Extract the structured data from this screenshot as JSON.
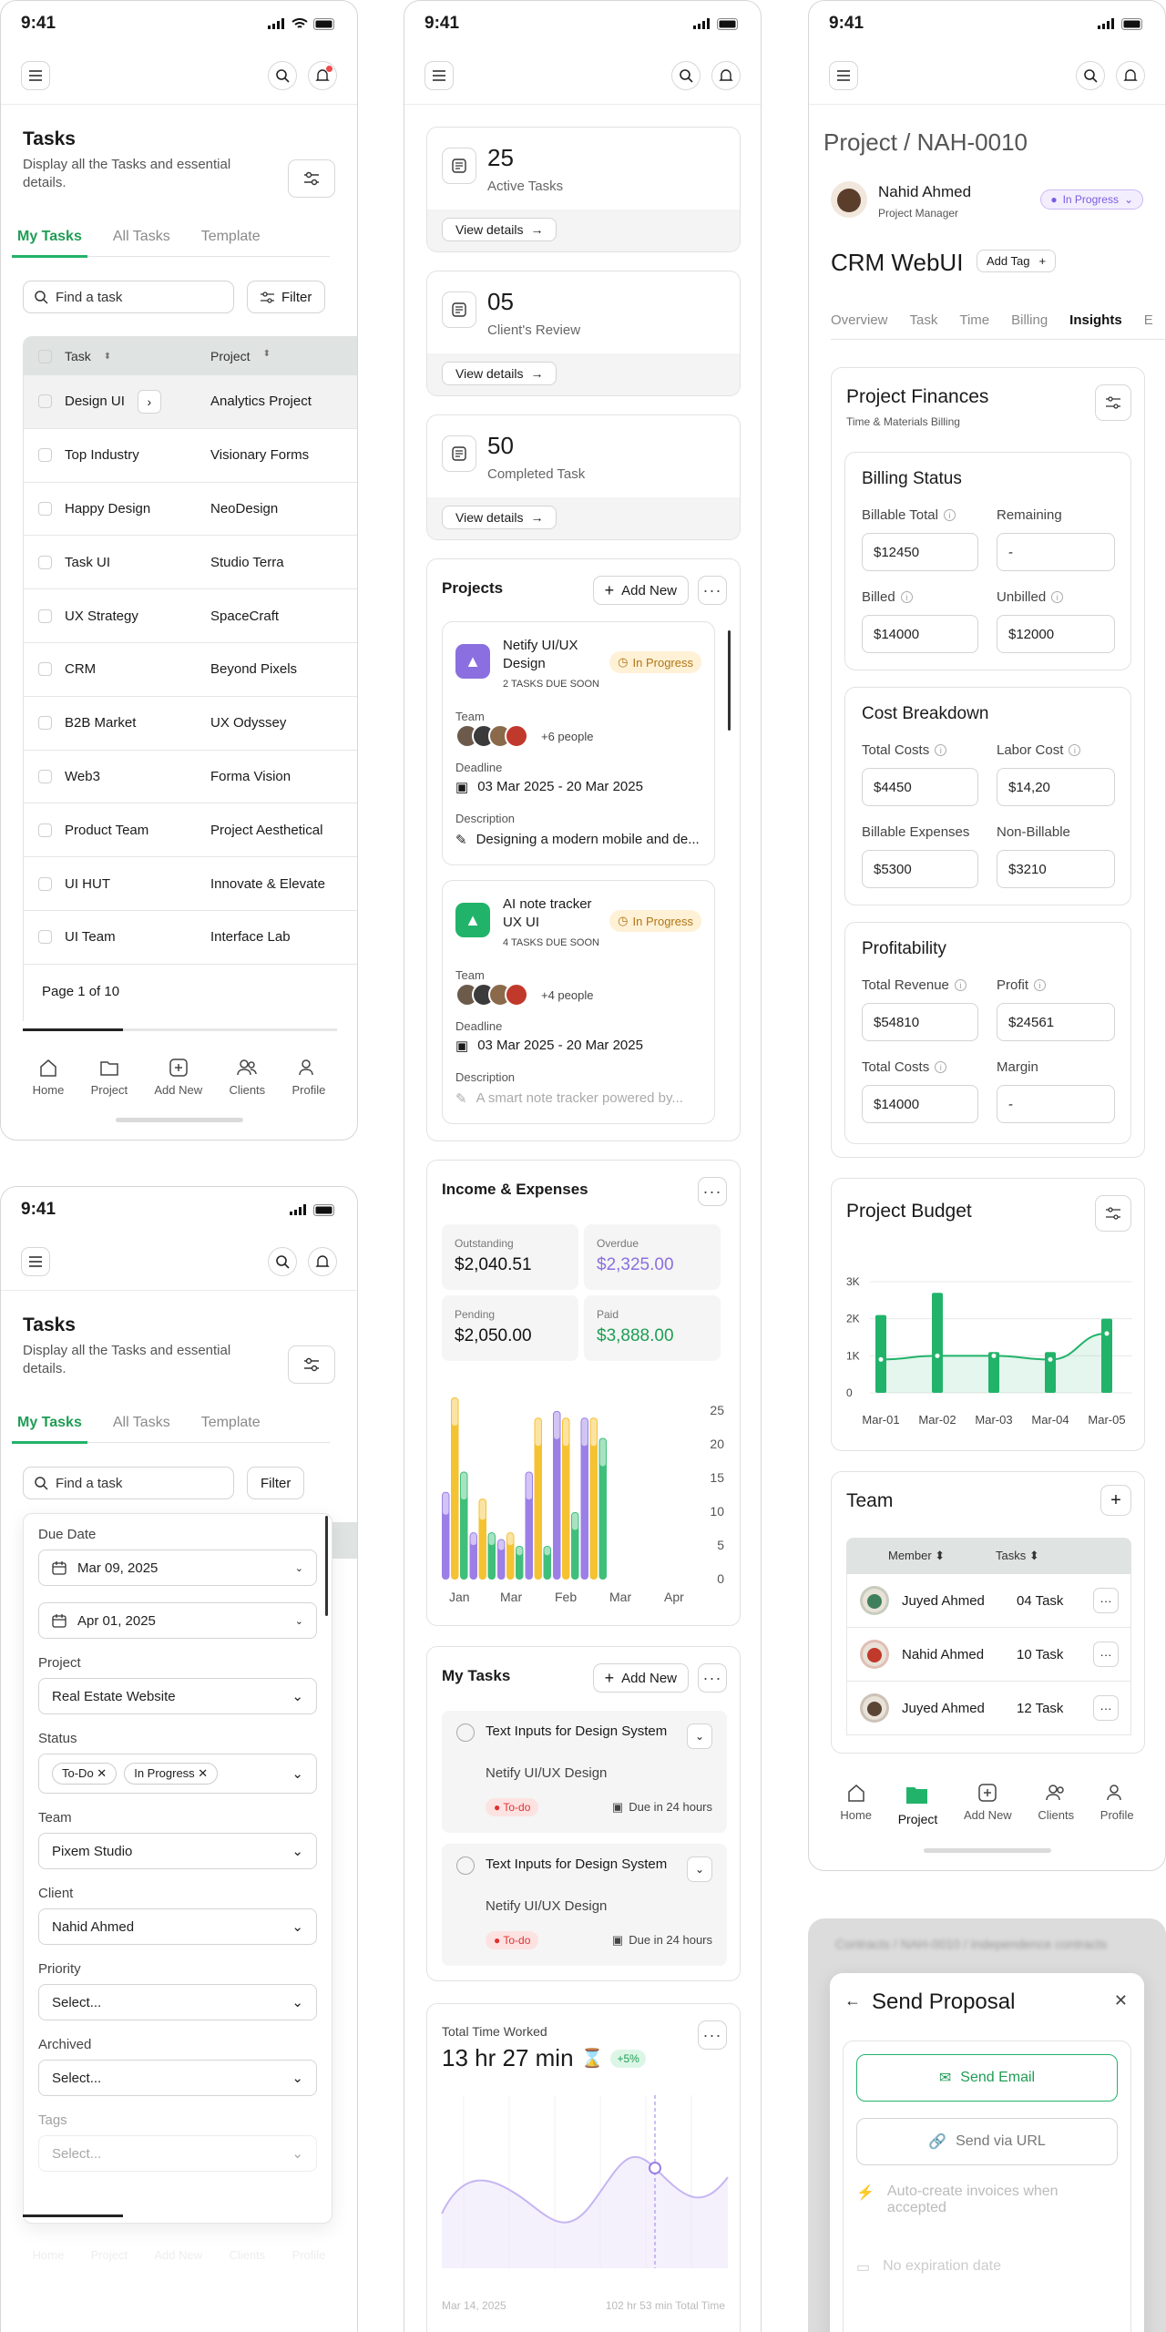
{
  "status_time": "9:41",
  "tasks": {
    "title": "Tasks",
    "subtitle": "Display all the Tasks and essential details.",
    "tabs": [
      "My Tasks",
      "All Tasks",
      "Template"
    ],
    "search_placeholder": "Find a task",
    "filter_label": "Filter",
    "col_task": "Task",
    "col_project": "Project",
    "rows": [
      {
        "task": "Design UI",
        "project": "Analytics Project"
      },
      {
        "task": "Top Industry",
        "project": "Visionary Forms"
      },
      {
        "task": "Happy Design",
        "project": "NeoDesign"
      },
      {
        "task": "Task UI",
        "project": "Studio Terra"
      },
      {
        "task": "UX Strategy",
        "project": "SpaceCraft"
      },
      {
        "task": "CRM",
        "project": "Beyond Pixels"
      },
      {
        "task": "B2B Market",
        "project": "UX Odyssey"
      },
      {
        "task": "Web3",
        "project": "Forma Vision"
      },
      {
        "task": "Product Team",
        "project": "Project Aesthetical"
      },
      {
        "task": "UI HUT",
        "project": "Innovate & Elevate"
      },
      {
        "task": "UI Team",
        "project": "Interface Lab"
      }
    ],
    "page_label": "Page 1 of 10"
  },
  "nav": {
    "home": "Home",
    "project": "Project",
    "add": "Add New",
    "clients": "Clients",
    "profile": "Profile"
  },
  "filter": {
    "due_label": "Due Date",
    "date_from": "Mar 09, 2025",
    "date_to": "Apr 01, 2025",
    "project_label": "Project",
    "project_value": "Real Estate Website",
    "status_label": "Status",
    "status_chips": [
      "To-Do",
      "In Progress"
    ],
    "team_label": "Team",
    "team_value": "Pixem Studio",
    "client_label": "Client",
    "client_value": "Nahid Ahmed",
    "priority_label": "Priority",
    "priority_value": "Select...",
    "archived_label": "Archived",
    "archived_value": "Select...",
    "tags_label": "Tags",
    "tags_value": "Select..."
  },
  "stats": [
    {
      "value": "25",
      "label": "Active Tasks",
      "button": "View details"
    },
    {
      "value": "05",
      "label": "Client's Review",
      "button": "View details"
    },
    {
      "value": "50",
      "label": "Completed Task",
      "button": "View details"
    }
  ],
  "projects": {
    "title": "Projects",
    "add": "Add New",
    "items": [
      {
        "name": "Netify UI/UX Design",
        "due": "2 TASKS DUE SOON",
        "status": "In Progress",
        "team_label": "Team",
        "more": "+6 people",
        "deadline_label": "Deadline",
        "deadline": "03 Mar 2025 - 20 Mar 2025",
        "desc_label": "Description",
        "desc": "Designing a modern mobile and de..."
      },
      {
        "name": "AI note tracker UX UI",
        "due": "4 TASKS DUE SOON",
        "status": "In Progress",
        "team_label": "Team",
        "more": "+4 people",
        "deadline_label": "Deadline",
        "deadline": "03 Mar 2025 - 20 Mar 2025",
        "desc_label": "Description",
        "desc": "A smart note tracker powered by..."
      }
    ]
  },
  "income": {
    "title": "Income & Expenses",
    "boxes": [
      {
        "label": "Outstanding",
        "value": "$2,040.51"
      },
      {
        "label": "Overdue",
        "value": "$2,325.00"
      },
      {
        "label": "Pending",
        "value": "$2,050.00"
      },
      {
        "label": "Paid",
        "value": "$3,888.00"
      }
    ]
  },
  "chart_data": [
    {
      "type": "bar",
      "categories": [
        "Jan",
        "",
        "Mar",
        "Feb",
        "",
        "Mar",
        "",
        "Apr",
        ""
      ],
      "ylim": [
        0,
        25
      ],
      "yticks": [
        "25",
        "20",
        "15",
        "10",
        "5",
        "0"
      ],
      "series": [
        {
          "color": "#9b7fe6",
          "values": [
            13,
            7,
            6,
            16,
            25,
            24
          ]
        },
        {
          "color": "#f5c232",
          "values": [
            27,
            12,
            7,
            24,
            24,
            24
          ]
        },
        {
          "color": "#3fbf7a",
          "values": [
            16,
            7,
            5,
            5,
            10,
            21
          ]
        }
      ]
    },
    {
      "type": "bar",
      "title": "Project Budget",
      "categories": [
        "Mar-01",
        "Mar-02",
        "Mar-03",
        "Mar-04",
        "Mar-05"
      ],
      "yticks": [
        "3K",
        "2K",
        "1K",
        "0"
      ],
      "values": [
        2100,
        2700,
        1100,
        1100,
        2000
      ],
      "line": [
        900,
        1000,
        1000,
        900,
        1600
      ]
    }
  ],
  "mytasks": {
    "title": "My Tasks",
    "add": "Add New",
    "items": [
      {
        "title": "Text Inputs for Design System",
        "project": "Netify UI/UX Design",
        "tag": "To-do",
        "due": "Due in 24 hours"
      },
      {
        "title": "Text Inputs for Design System",
        "project": "Netify UI/UX Design",
        "tag": "To-do",
        "due": "Due in 24 hours"
      }
    ]
  },
  "time": {
    "title": "Total Time Worked",
    "value": "13 hr 27 min",
    "delta": "+5%",
    "date": "Mar 14, 2025",
    "note": "102 hr 53 min Total Time"
  },
  "detail": {
    "breadcrumb": "Project / NAH-0010",
    "person": "Nahid Ahmed",
    "role": "Project Manager",
    "status": "In Progress",
    "project": "CRM WebUI",
    "add_tag": "Add Tag",
    "tabs": [
      "Overview",
      "Task",
      "Time",
      "Billing",
      "Insights",
      "E"
    ],
    "fin_title": "Project Finances",
    "fin_sub": "Time & Materials Billing",
    "billing": {
      "title": "Billing Status",
      "billable_total": "Billable Total",
      "billable_total_v": "$12450",
      "remaining": "Remaining",
      "remaining_v": "-",
      "billed": "Billed",
      "billed_v": "$14000",
      "unbilled": "Unbilled",
      "unbilled_v": "$12000"
    },
    "cost": {
      "title": "Cost Breakdown",
      "total_costs": "Total Costs",
      "total_costs_v": "$4450",
      "labor": "Labor Cost",
      "labor_v": "$14,20",
      "billable_exp": "Billable Expenses",
      "billable_exp_v": "$5300",
      "nonbill": "Non-Billable",
      "nonbill_v": "$3210"
    },
    "profit": {
      "title": "Profitability",
      "revenue": "Total Revenue",
      "revenue_v": "$54810",
      "profit": "Profit",
      "profit_v": "$24561",
      "total_costs": "Total Costs",
      "total_costs_v": "$14000",
      "margin": "Margin",
      "margin_v": "-"
    },
    "team": {
      "title": "Team",
      "col_member": "Member",
      "col_tasks": "Tasks",
      "rows": [
        {
          "name": "Juyed Ahmed",
          "tasks": "04 Task"
        },
        {
          "name": "Nahid Ahmed",
          "tasks": "10 Task"
        },
        {
          "name": "Juyed Ahmed",
          "tasks": "12 Task"
        }
      ]
    }
  },
  "proposal": {
    "crumb": "Contracts / NAH-0010 / Independence contracts",
    "title": "Send Proposal",
    "email": "Send Email",
    "url": "Send via URL",
    "auto": "Auto-create invoices when accepted",
    "noexp": "No expiration date"
  }
}
